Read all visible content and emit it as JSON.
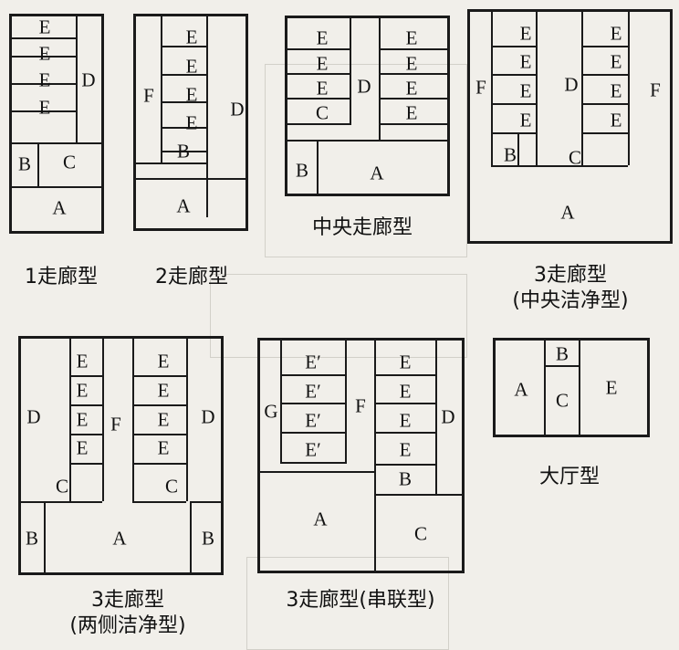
{
  "labels": {
    "A": "A",
    "B": "B",
    "C": "C",
    "D": "D",
    "E": "E",
    "E_prime": "E′",
    "F": "F",
    "G": "G"
  },
  "captions": {
    "p1": "1走廊型",
    "p2": "2走廊型",
    "p3": "中央走廊型",
    "p4_line1": "3走廊型",
    "p4_line2": "(中央洁净型)",
    "p5_line1": "3走廊型",
    "p5_line2": "(两侧洁净型)",
    "p6": "3走廊型(串联型)",
    "p7": "大厅型"
  }
}
